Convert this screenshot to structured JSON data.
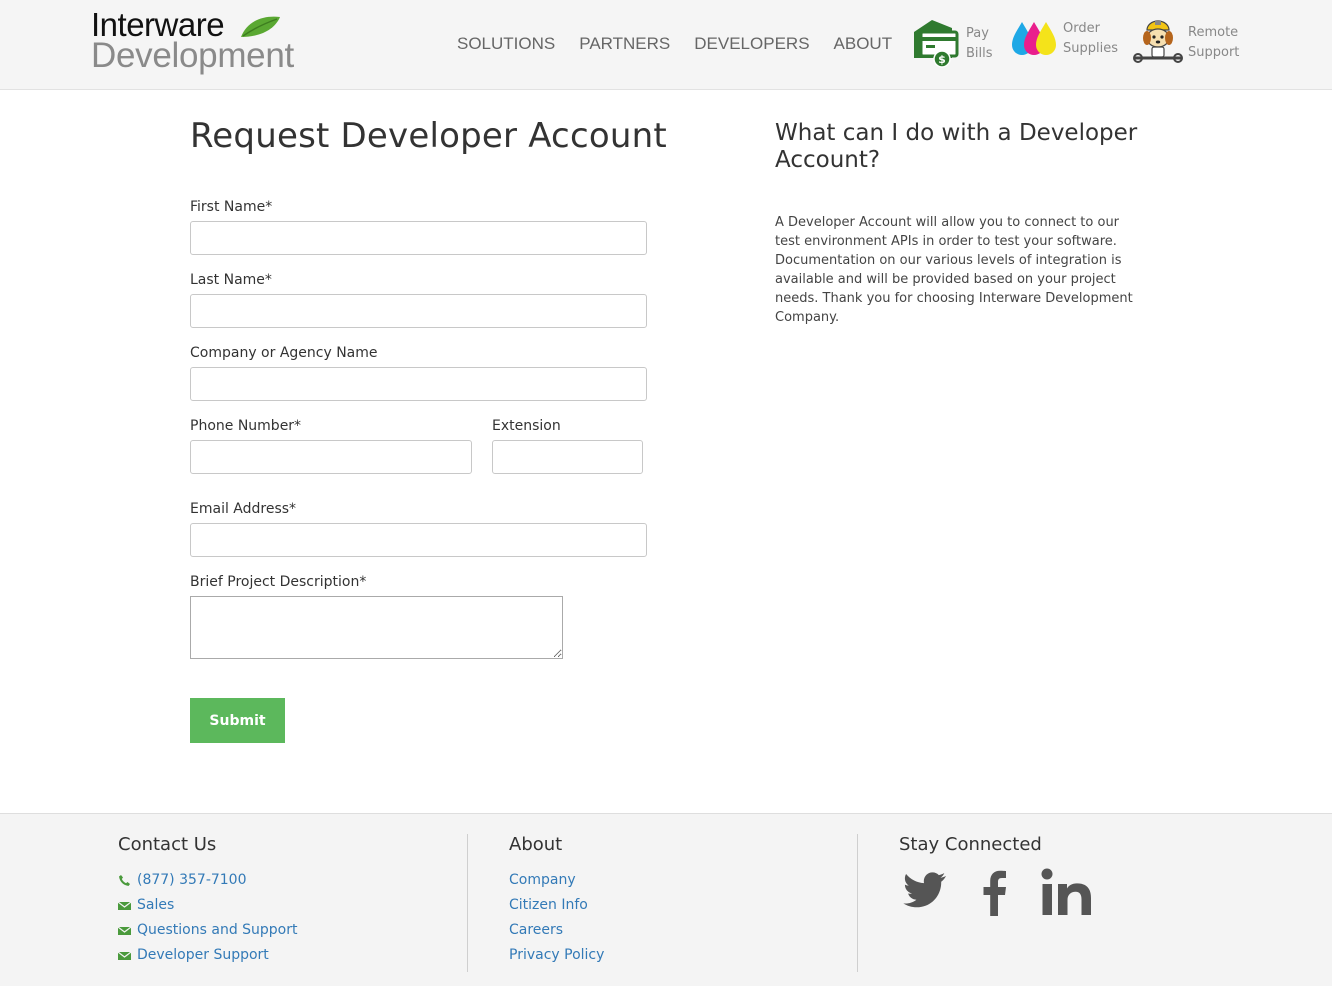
{
  "logo": {
    "line1": "Interware",
    "line2": "Development"
  },
  "nav": {
    "items": [
      {
        "label": "SOLUTIONS"
      },
      {
        "label": "PARTNERS"
      },
      {
        "label": "DEVELOPERS"
      },
      {
        "label": "ABOUT"
      }
    ]
  },
  "quick_links": {
    "pay": {
      "line1": "Pay",
      "line2": "Bills",
      "icon": "bill-payment-icon"
    },
    "order": {
      "line1": "Order",
      "line2": "Supplies",
      "icon": "ink-drops-icon"
    },
    "remote": {
      "line1": "Remote",
      "line2": "Support",
      "icon": "support-dog-icon"
    }
  },
  "form": {
    "title": "Request Developer Account",
    "first_name_label": "First Name*",
    "last_name_label": "Last Name*",
    "company_label": "Company or Agency Name",
    "phone_label": "Phone Number*",
    "extension_label": "Extension",
    "email_label": "Email Address*",
    "description_label": "Brief Project Description*",
    "first_name_value": "",
    "last_name_value": "",
    "company_value": "",
    "phone_value": "",
    "extension_value": "",
    "email_value": "",
    "description_value": "",
    "submit_label": "Submit"
  },
  "sidebar": {
    "title": "What can I do with a Developer Account?",
    "text": "A Developer Account will allow you to connect to our test environment APIs in order to test your software. Documentation on our various levels of integration is available and will be provided based on your project needs. Thank you for choosing Interware Development Company."
  },
  "footer": {
    "contact": {
      "heading": "Contact Us",
      "links": [
        {
          "label": "(877) 357-7100",
          "icon": "phone-icon"
        },
        {
          "label": "Sales",
          "icon": "envelope-icon"
        },
        {
          "label": "Questions and Support",
          "icon": "envelope-icon"
        },
        {
          "label": "Developer Support",
          "icon": "envelope-icon"
        }
      ]
    },
    "about": {
      "heading": "About",
      "links": [
        {
          "label": "Company"
        },
        {
          "label": "Citizen Info"
        },
        {
          "label": "Careers"
        },
        {
          "label": "Privacy Policy"
        }
      ]
    },
    "social": {
      "heading": "Stay Connected",
      "icons": [
        "twitter-icon",
        "facebook-icon",
        "linkedin-icon"
      ]
    }
  },
  "colors": {
    "accent_green": "#5cb85c",
    "link_blue": "#337ab7",
    "icon_green": "#4a9a3c",
    "social_gray": "#555555"
  }
}
